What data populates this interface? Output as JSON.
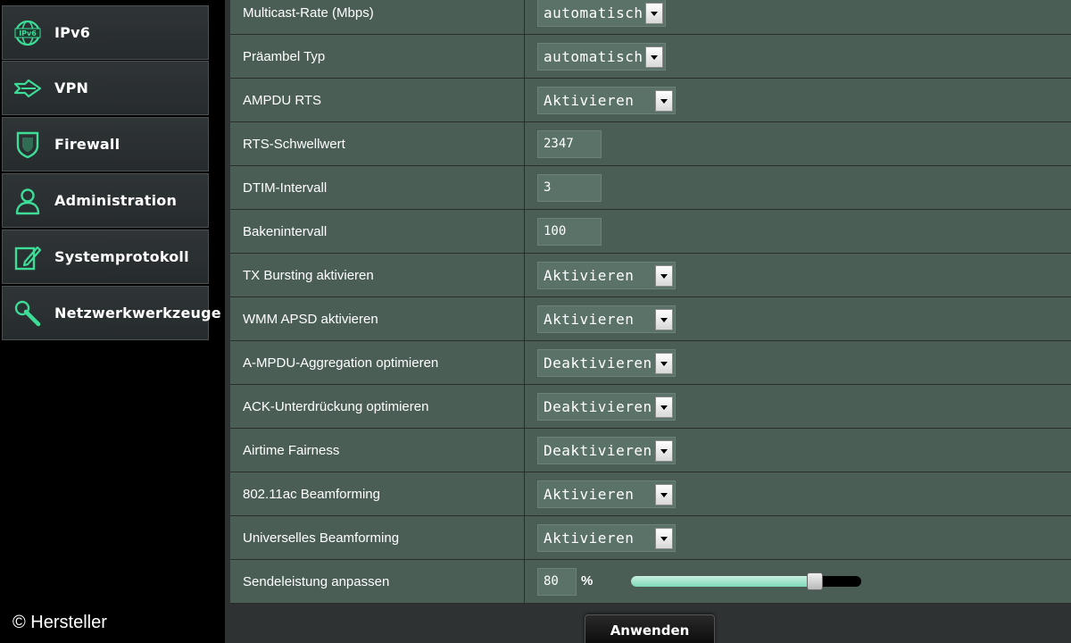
{
  "sidebar": {
    "items": [
      {
        "label": "IPv6",
        "icon": "ipv6-globe-icon"
      },
      {
        "label": "VPN",
        "icon": "vpn-icon"
      },
      {
        "label": "Firewall",
        "icon": "shield-icon"
      },
      {
        "label": "Administration",
        "icon": "user-icon"
      },
      {
        "label": "Systemprotokoll",
        "icon": "log-edit-icon"
      },
      {
        "label": "Netzwerkwerkzeuge",
        "icon": "wrench-icon"
      }
    ]
  },
  "watermark": "© Hersteller",
  "settings": {
    "rows": [
      {
        "label": "Multicast-Rate (Mbps)",
        "type": "select",
        "value": "automatisch"
      },
      {
        "label": "Präambel Typ",
        "type": "select",
        "value": "automatisch"
      },
      {
        "label": "AMPDU RTS",
        "type": "select",
        "value": "Aktivieren"
      },
      {
        "label": "RTS-Schwellwert",
        "type": "text",
        "value": "2347"
      },
      {
        "label": "DTIM-Intervall",
        "type": "text",
        "value": "3"
      },
      {
        "label": "Bakenintervall",
        "type": "text",
        "value": "100"
      },
      {
        "label": "TX Bursting aktivieren",
        "type": "select",
        "value": "Aktivieren"
      },
      {
        "label": "WMM APSD aktivieren",
        "type": "select",
        "value": "Aktivieren"
      },
      {
        "label": "A-MPDU-Aggregation optimieren",
        "type": "select",
        "value": "Deaktivieren"
      },
      {
        "label": "ACK-Unterdrückung optimieren",
        "type": "select",
        "value": "Deaktivieren"
      },
      {
        "label": "Airtime Fairness",
        "type": "select",
        "value": "Deaktivieren"
      },
      {
        "label": "802.11ac Beamforming",
        "type": "select",
        "value": "Aktivieren"
      },
      {
        "label": "Universelles Beamforming",
        "type": "select",
        "value": "Aktivieren"
      }
    ],
    "power": {
      "label": "Sendeleistung anpassen",
      "value": "80",
      "unit": "%",
      "slider_level": 0.8
    }
  },
  "apply_button": "Anwenden",
  "colors": {
    "accent_green": "#3ddc97",
    "row_background": "#4a5e56",
    "field_background": "#5a7268"
  }
}
